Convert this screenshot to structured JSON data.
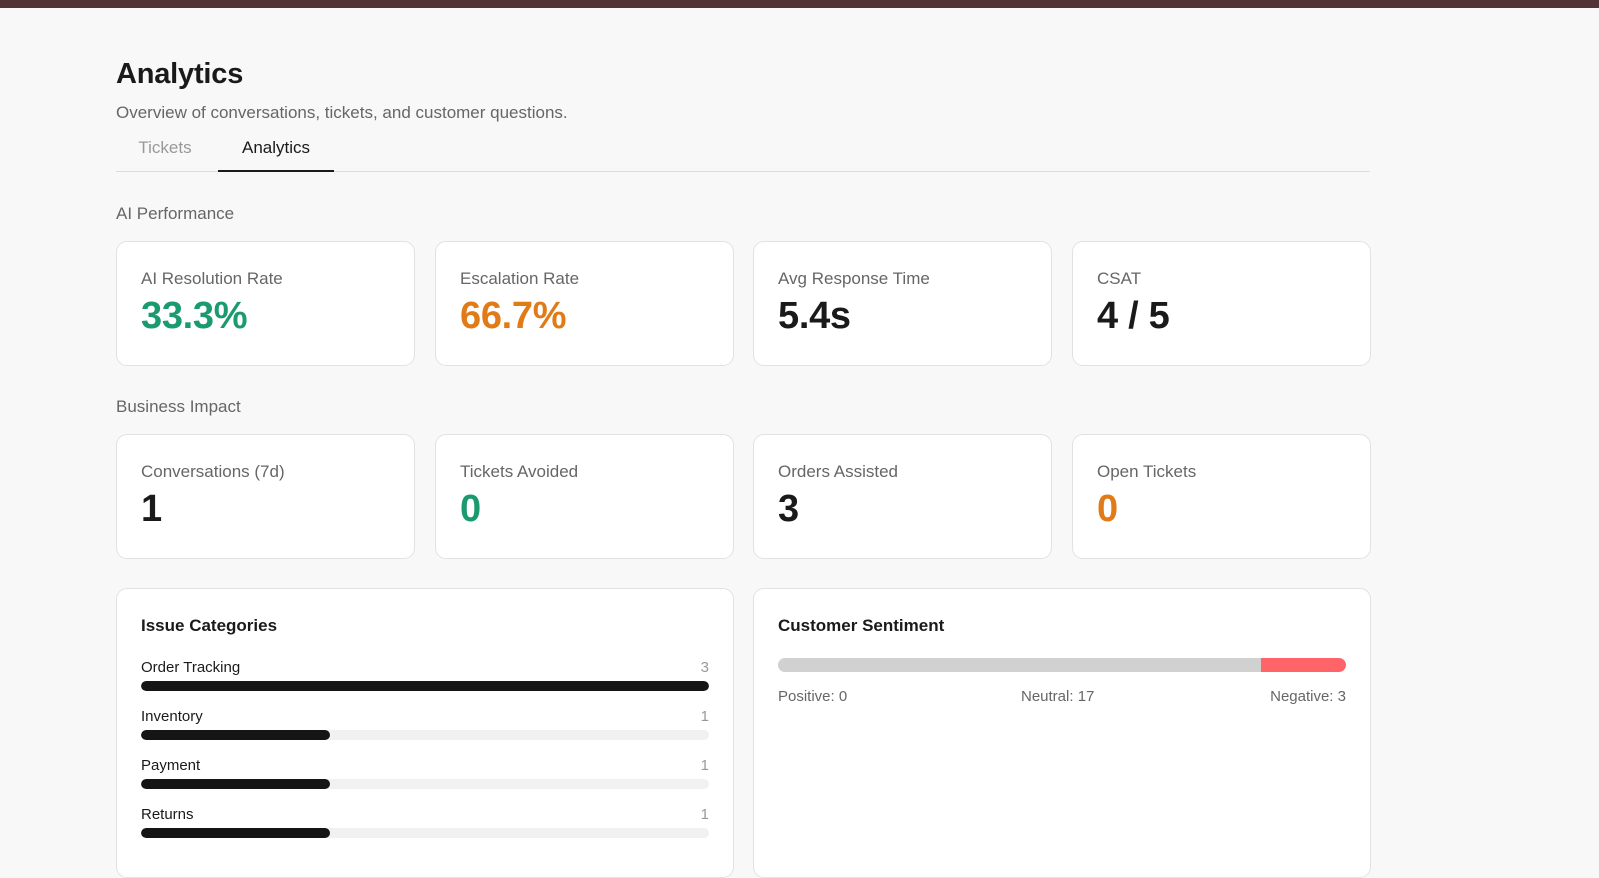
{
  "header": {
    "title": "Analytics",
    "subtitle": "Overview of conversations, tickets, and customer questions."
  },
  "tabs": [
    {
      "label": "Tickets",
      "active": false
    },
    {
      "label": "Analytics",
      "active": true
    }
  ],
  "ai_performance": {
    "section_title": "AI Performance",
    "cards": [
      {
        "label": "AI Resolution Rate",
        "value": "33.3%",
        "color": "#1a9a6e"
      },
      {
        "label": "Escalation Rate",
        "value": "66.7%",
        "color": "#e07b18"
      },
      {
        "label": "Avg Response Time",
        "value": "5.4s",
        "color": "#1a1a1a"
      },
      {
        "label": "CSAT",
        "value": "4 / 5",
        "color": "#1a1a1a"
      }
    ]
  },
  "business_impact": {
    "section_title": "Business Impact",
    "cards": [
      {
        "label": "Conversations (7d)",
        "value": "1",
        "color": "#1a1a1a"
      },
      {
        "label": "Tickets Avoided",
        "value": "0",
        "color": "#1a9a6e"
      },
      {
        "label": "Orders Assisted",
        "value": "3",
        "color": "#1a1a1a"
      },
      {
        "label": "Open Tickets",
        "value": "0",
        "color": "#e07b18"
      }
    ]
  },
  "issue_categories": {
    "title": "Issue Categories",
    "items": [
      {
        "name": "Order Tracking",
        "count": "3"
      },
      {
        "name": "Inventory",
        "count": "1"
      },
      {
        "name": "Payment",
        "count": "1"
      },
      {
        "name": "Returns",
        "count": "1"
      }
    ]
  },
  "sentiment": {
    "title": "Customer Sentiment",
    "positive_label": "Positive: 0",
    "neutral_label": "Neutral: 17",
    "negative_label": "Negative: 3",
    "positive": 0,
    "neutral": 17,
    "negative": 3
  },
  "colors": {
    "top_bar": "#523237",
    "green": "#1a9a6e",
    "orange": "#e07b18",
    "bar_fill": "#151515",
    "negative": "#ff6468",
    "neutral": "#d1d1d1"
  }
}
